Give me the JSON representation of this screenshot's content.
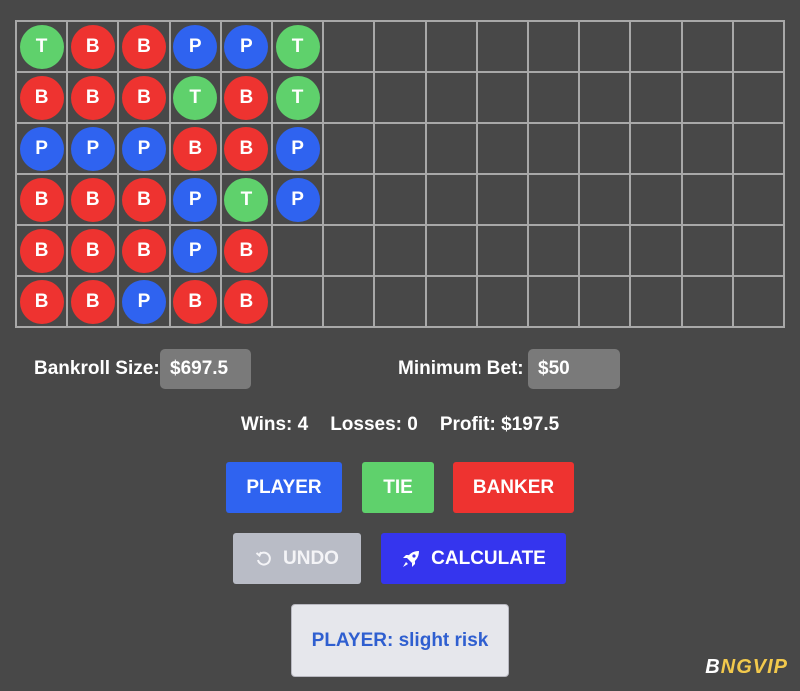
{
  "bead_road": {
    "rows": [
      [
        "T",
        "B",
        "B",
        "P",
        "P",
        "T",
        "",
        "",
        "",
        "",
        "",
        "",
        "",
        "",
        ""
      ],
      [
        "B",
        "B",
        "B",
        "T",
        "B",
        "T",
        "",
        "",
        "",
        "",
        "",
        "",
        "",
        "",
        ""
      ],
      [
        "P",
        "P",
        "P",
        "B",
        "B",
        "P",
        "",
        "",
        "",
        "",
        "",
        "",
        "",
        "",
        ""
      ],
      [
        "B",
        "B",
        "B",
        "P",
        "T",
        "P",
        "",
        "",
        "",
        "",
        "",
        "",
        "",
        "",
        ""
      ],
      [
        "B",
        "B",
        "B",
        "P",
        "B",
        "",
        "",
        "",
        "",
        "",
        "",
        "",
        "",
        "",
        ""
      ],
      [
        "B",
        "B",
        "P",
        "B",
        "B",
        "",
        "",
        "",
        "",
        "",
        "",
        "",
        "",
        "",
        ""
      ]
    ]
  },
  "bankroll": {
    "label": "Bankroll Size:",
    "value": "$697.5"
  },
  "min_bet": {
    "label": "Minimum Bet:",
    "value": "$50"
  },
  "stats": {
    "wins": "Wins: 4",
    "losses": "Losses: 0",
    "profit": "Profit: $197.5"
  },
  "buttons": {
    "player": "PLAYER",
    "tie": "TIE",
    "banker": "BANKER",
    "undo": "UNDO",
    "calculate": "CALCULATE"
  },
  "result": "PLAYER: slight risk",
  "watermark": {
    "part1": "B",
    "part2": "NGVIP"
  },
  "colors": {
    "banker": "#ee3330",
    "player": "#2f63f0",
    "tie": "#5fd16c",
    "calculate": "#3535ee"
  }
}
